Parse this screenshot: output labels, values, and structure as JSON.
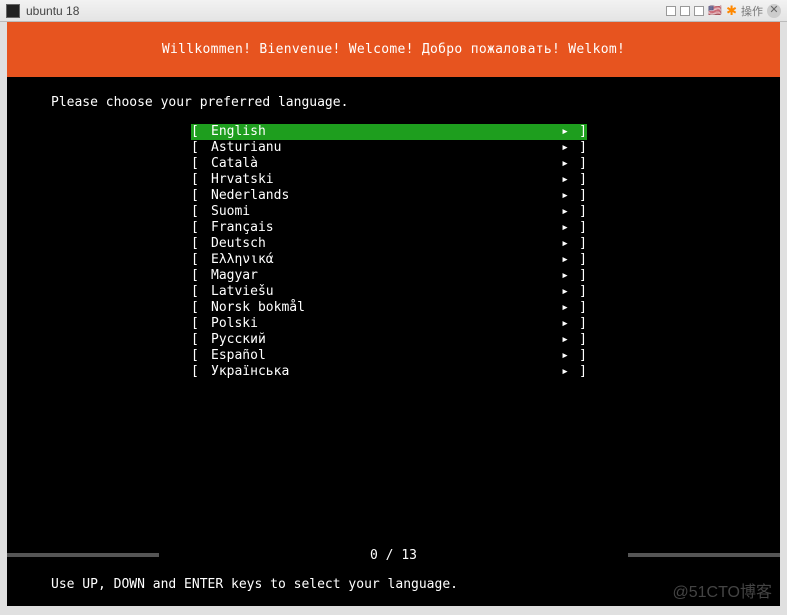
{
  "titlebar": {
    "title": "ubuntu 18",
    "action_text": "操作"
  },
  "header_text": "Willkommen! Bienvenue! Welcome! Добро пожаловать! Welkom!",
  "prompt": "Please choose your preferred language.",
  "selected_index": 0,
  "languages": [
    {
      "name": "English"
    },
    {
      "name": "Asturianu"
    },
    {
      "name": "Català"
    },
    {
      "name": "Hrvatski"
    },
    {
      "name": "Nederlands"
    },
    {
      "name": "Suomi"
    },
    {
      "name": "Français"
    },
    {
      "name": "Deutsch"
    },
    {
      "name": "Ελληνικά"
    },
    {
      "name": "Magyar"
    },
    {
      "name": "Latviešu"
    },
    {
      "name": "Norsk bokmål"
    },
    {
      "name": "Polski"
    },
    {
      "name": "Русский"
    },
    {
      "name": "Español"
    },
    {
      "name": "Українська"
    }
  ],
  "brackets": {
    "left": "[ ",
    "right": " ]",
    "arrow": "▸"
  },
  "progress": {
    "current": 0,
    "total": 13,
    "text": "0 / 13"
  },
  "hint": "Use UP, DOWN and ENTER keys to select your language.",
  "watermark": "@51CTO博客"
}
